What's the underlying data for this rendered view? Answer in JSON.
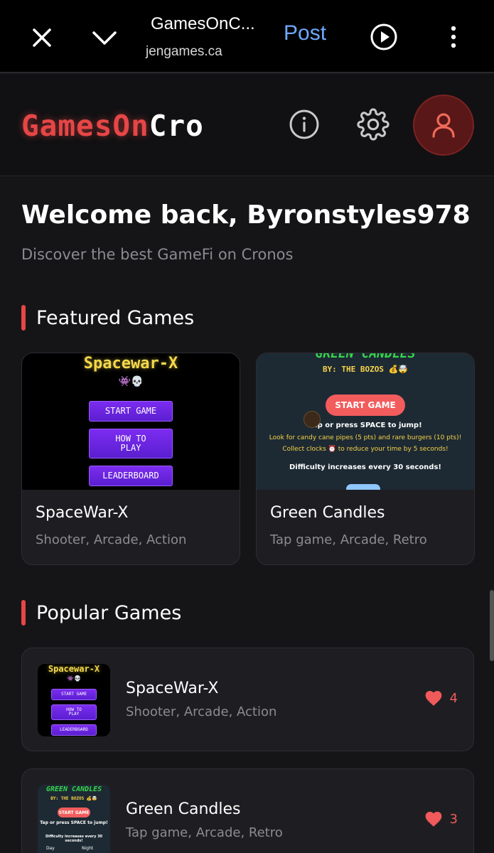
{
  "browser": {
    "title": "GamesOnC...",
    "url": "jengames.ca",
    "post_label": "Post"
  },
  "header": {
    "logo_red": "GamesOn",
    "logo_white": "Cro"
  },
  "welcome": {
    "title": "Welcome back, Byronstyles978",
    "subtitle": "Discover the best GameFi on Cronos"
  },
  "featured": {
    "heading": "Featured Games",
    "games": [
      {
        "name": "SpaceWar-X",
        "tags": "Shooter, Arcade, Action",
        "thumb": {
          "title": "Spacewar-X",
          "start": "START GAME",
          "how_line1": "HOW TO",
          "how_line2": "PLAY",
          "leaderboard": "LEADERBOARD"
        }
      },
      {
        "name": "Green Candles",
        "tags": "Tap game, Arcade, Retro",
        "thumb": {
          "title": "GREEN CANDLES",
          "by": "BY: THE BOZOS",
          "start": "START GAME",
          "line1": "Tap or press SPACE to jump!",
          "line2": "Look for candy cane pipes (5 pts) and rare burgers (10 pts)!",
          "line3": "Collect clocks ⏰ to reduce your time by 5 seconds!",
          "line4": "Difficulty increases every 30 seconds!"
        }
      }
    ]
  },
  "popular": {
    "heading": "Popular Games",
    "games": [
      {
        "name": "SpaceWar-X",
        "tags": "Shooter, Arcade, Action",
        "likes": "4"
      },
      {
        "name": "Green Candles",
        "tags": "Tap game, Arcade, Retro",
        "likes": "3"
      }
    ],
    "thumb_gc": {
      "title": "GREEN CANDLES",
      "by": "BY: THE BOZOS",
      "start": "START GAME",
      "line1": "Tap or press SPACE to jump!",
      "line4": "Difficulty increases every 30 seconds!",
      "day": "Day",
      "night": "Night"
    }
  },
  "colors": {
    "accent": "#e64646",
    "link": "#6ea8ff",
    "like": "#f05a5a"
  }
}
